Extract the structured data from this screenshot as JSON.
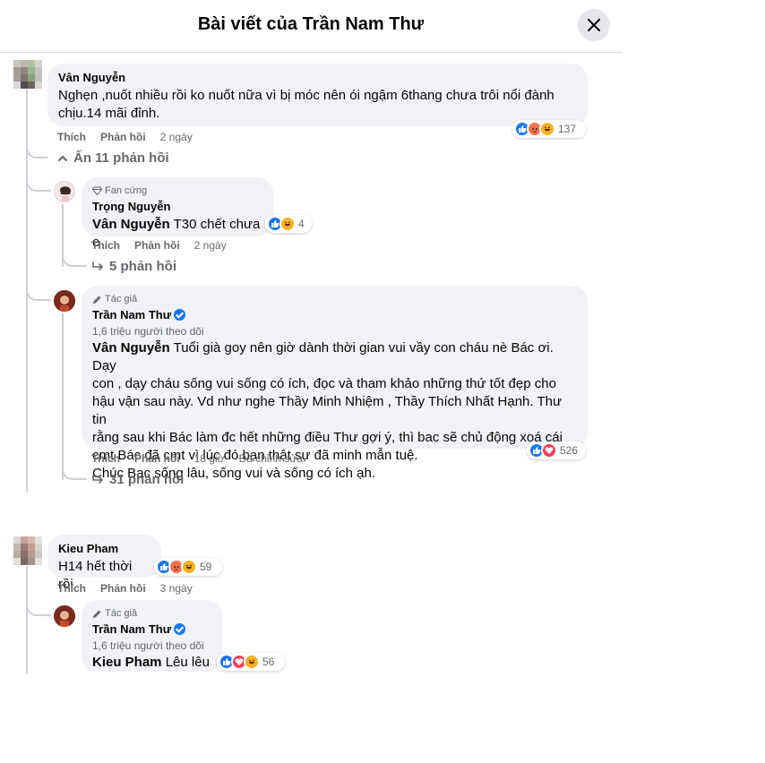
{
  "header": {
    "title": "Bài viết của Trần Nam Thư"
  },
  "comments": [
    {
      "author": "Vân Nguyễn",
      "text_line1": "Nghẹn ,nuốt nhiều rồi ko nuốt nữa vì bị móc nên ói ngậm 6thang chưa trôi nổi đành",
      "text_line2": "chịu.14 mãi đỉnh.",
      "like": "Thích",
      "reply": "Phản hồi",
      "time": "2 ngày",
      "reaction_count": "137",
      "hide_replies": "Ẩn 11 phản hồi",
      "replies": [
        {
          "badge": "Fan cứng",
          "author": "Trọng Nguyễn",
          "mention": "Vân Nguyễn",
          "text": " T30 chết chưa e",
          "like": "Thích",
          "reply": "Phản hồi",
          "time": "2 ngày",
          "reaction_count": "4",
          "more_replies": "5 phản hồi"
        },
        {
          "badge": "Tác giả",
          "author": "Trần Nam Thư",
          "followers": "1,6 triệu người theo dõi",
          "mention": "Vân Nguyễn",
          "lines": [
            " Tuổi già goy nên giờ dành thời gian vui vầy con cháu nè Bác ơi. Dạy",
            "con , dạy cháu sống vui sống có ích, đọc và tham khảo những thứ tốt đẹp cho",
            "hậu vận sau này. Vd như nghe Thầy Minh Nhiệm , Thầy Thích Nhất Hạnh. Thư tin",
            "rằng sau khi Bác làm đc hết những điều Thư gợi ý, thì bac sẽ chủ động xoá cái",
            "cmt Bác đã cmt vì lúc đó bạn thật sự đã minh mẫn tuệ.",
            "Chúc Bac sống lâu, sống vui và sống có ích ạh."
          ],
          "like": "Thích",
          "reply": "Phản hồi",
          "time": "18 giờ",
          "edited": "Đã chỉnh sửa",
          "reaction_count": "526",
          "more_replies": "31 phản hồi"
        }
      ]
    },
    {
      "author": "Kieu Pham",
      "text": "H14 hết thời rồi",
      "like": "Thích",
      "reply": "Phản hồi",
      "time": "3 ngày",
      "reaction_count": "59",
      "replies": [
        {
          "badge": "Tác giả",
          "author": "Trần Nam Thư",
          "followers": "1,6 triệu người theo dõi",
          "mention": "Kieu Pham",
          "text": " Lêu lêu",
          "reaction_count": "56"
        }
      ]
    }
  ],
  "icons": {
    "close": "close-icon",
    "fan_badge": "diamond-icon",
    "author_badge": "pencil-icon",
    "reply_arrow": "reply-arrow-icon",
    "collapse": "chevron-up-icon"
  },
  "colors": {
    "bubble": "#f0f2f5",
    "accent": "#1877f2",
    "secondary_text": "#65676b"
  }
}
